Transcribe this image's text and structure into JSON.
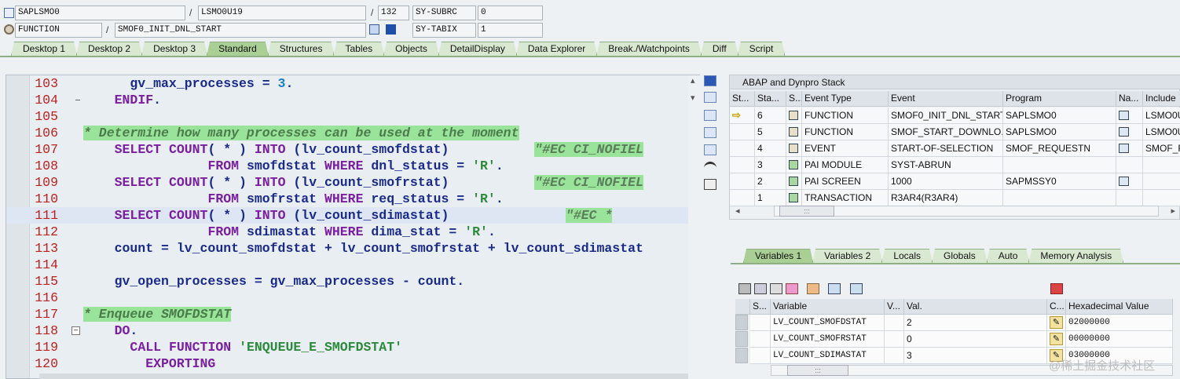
{
  "header": {
    "program_field": "SAPLSMO0",
    "include_field": "LSMO0U19",
    "line_field": "132",
    "sy_subrc_label": "SY-SUBRC",
    "sy_subrc_value": "0",
    "type_field": "FUNCTION",
    "name_field": "SMOF0_INIT_DNL_START",
    "sy_tabix_label": "SY-TABIX",
    "sy_tabix_value": "1",
    "slash": "/"
  },
  "main_tabs": [
    "Desktop 1",
    "Desktop 2",
    "Desktop 3",
    "Standard",
    "Structures",
    "Tables",
    "Objects",
    "DetailDisplay",
    "Data Explorer",
    "Break./Watchpoints",
    "Diff",
    "Script"
  ],
  "active_tab": "Standard",
  "code_lines": [
    {
      "n": "103",
      "t": "      gv_max_processes = 3."
    },
    {
      "n": "104",
      "t": "    ENDIF."
    },
    {
      "n": "105",
      "t": ""
    },
    {
      "n": "106",
      "t": "* Determine how many processes can be used at the moment"
    },
    {
      "n": "107",
      "t": "    SELECT COUNT( * ) INTO (lv_count_smofdstat)           \"#EC CI_NOFIEL"
    },
    {
      "n": "108",
      "t": "                FROM smofdstat WHERE dnl_status = 'R'."
    },
    {
      "n": "109",
      "t": "    SELECT COUNT( * ) INTO (lv_count_smofrstat)           \"#EC CI_NOFIEL"
    },
    {
      "n": "110",
      "t": "                FROM smofrstat WHERE req_status = 'R'."
    },
    {
      "n": "111",
      "t": "    SELECT COUNT( * ) INTO (lv_count_sdimastat)               \"#EC *"
    },
    {
      "n": "112",
      "t": "                FROM sdimastat WHERE dima_stat = 'R'."
    },
    {
      "n": "113",
      "t": "    count = lv_count_smofdstat + lv_count_smofrstat + lv_count_sdimastat"
    },
    {
      "n": "114",
      "t": ""
    },
    {
      "n": "115",
      "t": "    gv_open_processes = gv_max_processes - count."
    },
    {
      "n": "116",
      "t": ""
    },
    {
      "n": "117",
      "t": "* Enqueue SMOFDSTAT"
    },
    {
      "n": "118",
      "t": "    DO."
    },
    {
      "n": "119",
      "t": "      CALL FUNCTION 'ENQUEUE_E_SMOFDSTAT'"
    },
    {
      "n": "120",
      "t": "        EXPORTING"
    }
  ],
  "stack": {
    "title": "ABAP and Dynpro Stack",
    "columns": [
      "St...",
      "Sta...",
      "S...",
      "Event Type",
      "Event",
      "Program",
      "Na...",
      "Include"
    ],
    "rows": [
      {
        "level": "6",
        "type": "FUNCTION",
        "event": "SMOF0_INIT_DNL_START",
        "program": "SAPLSMO0",
        "include": "LSMO0U"
      },
      {
        "level": "5",
        "type": "FUNCTION",
        "event": "SMOF_START_DOWNLO...",
        "program": "SAPLSMO0",
        "include": "LSMO0U"
      },
      {
        "level": "4",
        "type": "EVENT",
        "event": "START-OF-SELECTION",
        "program": "SMOF_REQUESTN",
        "include": "SMOF_F"
      },
      {
        "level": "3",
        "type": "PAI MODULE",
        "event": "SYST-ABRUN",
        "program": "",
        "include": ""
      },
      {
        "level": "2",
        "type": "PAI SCREEN",
        "event": "1000",
        "program": "SAPMSSY0",
        "include": ""
      },
      {
        "level": "1",
        "type": "TRANSACTION",
        "event": "R3AR4(R3AR4)",
        "program": "",
        "include": ""
      }
    ]
  },
  "var_tabs": [
    "Variables 1",
    "Variables 2",
    "Locals",
    "Globals",
    "Auto",
    "Memory Analysis"
  ],
  "active_var_tab": "Variables 1",
  "variables": {
    "columns": [
      "S...",
      "Variable",
      "V...",
      "Val.",
      "C...",
      "Hexadecimal Value"
    ],
    "rows": [
      {
        "name": "LV_COUNT_SMOFDSTAT",
        "value": "2",
        "hex": "02000000"
      },
      {
        "name": "LV_COUNT_SMOFRSTAT",
        "value": "0",
        "hex": "00000000"
      },
      {
        "name": "LV_COUNT_SDIMASTAT",
        "value": "3",
        "hex": "03000000"
      }
    ]
  },
  "watermark": "@稀土掘金技术社区",
  "scroll_grip": ":::",
  "glyphs": {
    "pencil": "✎",
    "arrow_left": "◂",
    "arrow_right": "▸",
    "arrow_up": "▴",
    "arrow_down": "▾",
    "minus": "−",
    "current": "⇨"
  }
}
